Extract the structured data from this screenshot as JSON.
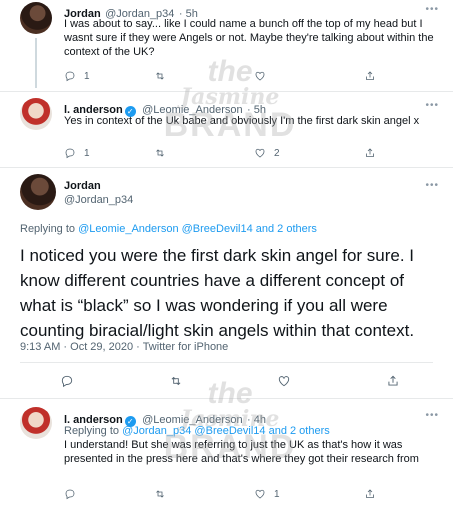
{
  "tweets": [
    {
      "name": "Jordan",
      "handle": "@Jordan_p34",
      "time": "· 5h",
      "text": "I was about to say... like I could name a bunch off the top of my head but I wasnt sure if they were Angels or not. Maybe they're talking about within the context of the UK?",
      "reply_count": "1",
      "retweet_count": "",
      "like_count": ""
    },
    {
      "name": "l. anderson",
      "handle": "@Leomie_Anderson",
      "time": "· 5h",
      "text": "Yes in context of the Uk babe and obviously I'm the first dark skin angel x",
      "reply_count": "1",
      "retweet_count": "",
      "like_count": "2"
    },
    {
      "name": "l. anderson",
      "handle": "@Leomie_Anderson",
      "time": "· 4h",
      "replying_prefix": "Replying to",
      "replying_mentions": "@Jordan_p34 @BreeDevil14 and 2 others",
      "text": "I understand! But she was referring to just the UK as that's how it was presented in the press here and that's where they got their research from",
      "reply_count": "",
      "retweet_count": "",
      "like_count": "1"
    }
  ],
  "main_tweet": {
    "name": "Jordan",
    "handle": "@Jordan_p34",
    "replying_prefix": "Replying to",
    "replying_mentions": "@Leomie_Anderson @BreeDevil14 and 2 others",
    "text": "I noticed you were the first dark skin angel for sure. I know different countries have a different concept of what is “black” so I was wondering if you all were counting biracial/light skin angels within that context.",
    "timestamp": "9:13 AM · Oct 29, 2020 · Twitter for iPhone"
  },
  "more_label": "•••",
  "watermark": {
    "line1": "the",
    "line2": "Jasmine",
    "line3": "BRAND"
  },
  "colors": {
    "link": "#1d9bf0",
    "text": "#0f1419",
    "muted": "#536471"
  },
  "icons": [
    "reply-icon",
    "retweet-icon",
    "like-icon",
    "share-icon",
    "verified-icon"
  ]
}
